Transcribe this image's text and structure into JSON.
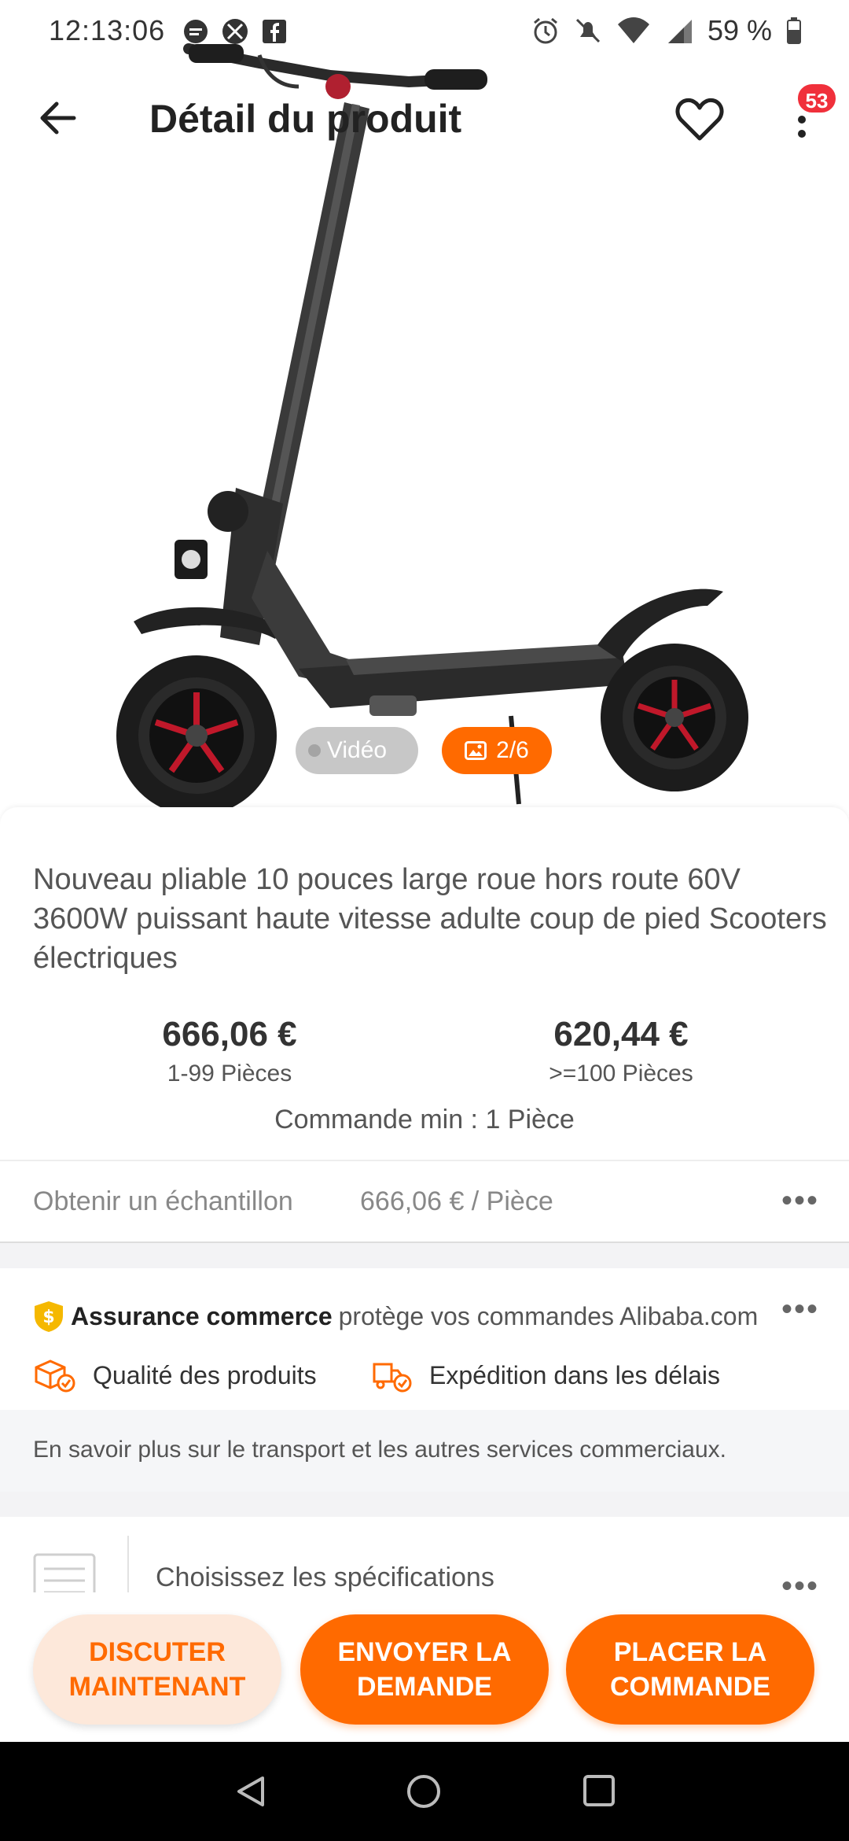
{
  "status_bar": {
    "time": "12:13:06",
    "battery": "59 %"
  },
  "header": {
    "title": "Détail du produit",
    "notification_count": "53"
  },
  "media": {
    "video_label": "Vidéo",
    "gallery_counter": "2/6"
  },
  "product": {
    "title": "Nouveau pliable 10 pouces large roue hors route 60V 3600W puissant haute vitesse adulte coup de pied Scooters électriques",
    "price_tiers": [
      {
        "price": "666,06 €",
        "quantity": "1-99 Pièces"
      },
      {
        "price": "620,44 €",
        "quantity": ">=100 Pièces"
      }
    ],
    "min_order": "Commande min : 1 Pièce"
  },
  "sample": {
    "label": "Obtenir un échantillon",
    "price": "666,06 € / Pièce"
  },
  "assurance": {
    "brand": "Assurance commerce",
    "text": "protège vos commandes Alibaba.com",
    "features": [
      "Qualité des produits",
      "Expédition dans les délais"
    ],
    "learn_more": "En savoir plus sur le transport et les autres services commerciaux."
  },
  "specs": {
    "label": "Choisissez les spécifications"
  },
  "actions": {
    "chat": "DISCUTER MAINTENANT",
    "inquiry": "ENVOYER LA DEMANDE",
    "order": "PLACER LA COMMANDE"
  },
  "colors": {
    "accent": "#ff6a00",
    "badge": "#f0303b"
  }
}
